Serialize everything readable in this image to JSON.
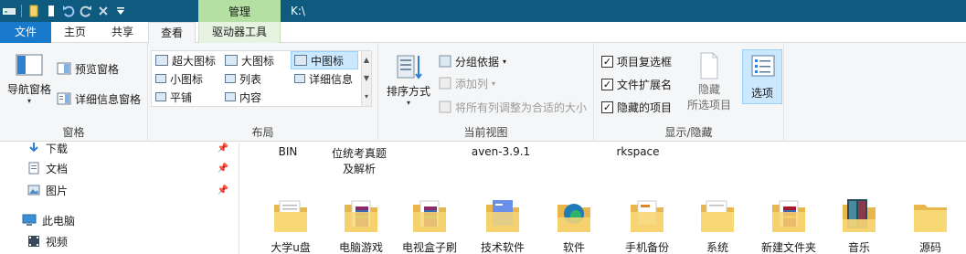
{
  "window": {
    "context_tab": "管理",
    "path": "K:\\"
  },
  "tabs": {
    "file": "文件",
    "home": "主页",
    "share": "共享",
    "view": "查看",
    "drive_tools": "驱动器工具"
  },
  "ribbon": {
    "panes": {
      "nav_pane": "导航窗格",
      "preview_pane": "预览窗格",
      "details_pane": "详细信息窗格",
      "label": "窗格"
    },
    "layout": {
      "items": [
        "超大图标",
        "大图标",
        "中图标",
        "小图标",
        "列表",
        "详细信息",
        "平铺",
        "内容"
      ],
      "selected": "中图标",
      "label": "布局"
    },
    "current_view": {
      "sort_by": "排序方式",
      "group_by": "分组依据",
      "add_columns": "添加列",
      "size_all_columns": "将所有列调整为合适的大小",
      "label": "当前视图"
    },
    "show_hide": {
      "item_checkboxes": "项目复选框",
      "file_extensions": "文件扩展名",
      "hidden_items": "隐藏的项目",
      "hide_selected_line1": "隐藏",
      "hide_selected_line2": "所选项目",
      "label": "显示/隐藏"
    },
    "options": "选项"
  },
  "nav": {
    "items": [
      {
        "label": "下载",
        "pinned": true
      },
      {
        "label": "文档",
        "pinned": true
      },
      {
        "label": "图片",
        "pinned": true
      },
      {
        "label": "此电脑",
        "pinned": false
      },
      {
        "label": "视频",
        "pinned": false
      }
    ]
  },
  "files": {
    "top_row": [
      {
        "line1": "BIN",
        "line2": ""
      },
      {
        "line1": "位统考真题",
        "line2": "及解析"
      },
      {
        "line1": "aven-3.9.1",
        "line2": ""
      },
      {
        "line1": "rkspace",
        "line2": ""
      }
    ],
    "bottom_row": [
      {
        "label": "大学u盘",
        "kind": "folder-doc"
      },
      {
        "label": "电脑游戏",
        "kind": "folder-winrar"
      },
      {
        "label": "电视盒子刷",
        "kind": "folder-winrar"
      },
      {
        "label": "技术软件",
        "kind": "folder-blue"
      },
      {
        "label": "软件",
        "kind": "folder-edge"
      },
      {
        "label": "手机备份",
        "kind": "folder-orange"
      },
      {
        "label": "系统",
        "kind": "folder-doc"
      },
      {
        "label": "新建文件夹",
        "kind": "folder-winrar"
      },
      {
        "label": "音乐",
        "kind": "folder-music"
      },
      {
        "label": "源码",
        "kind": "folder-plain"
      }
    ]
  }
}
